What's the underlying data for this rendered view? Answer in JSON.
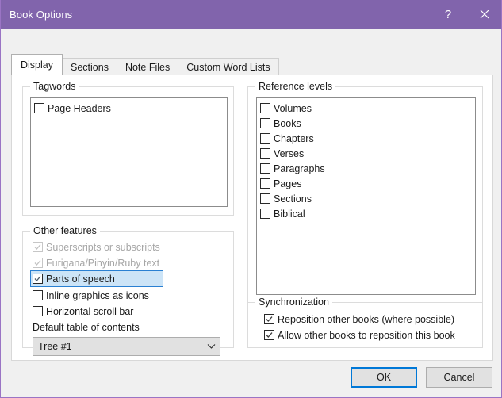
{
  "window": {
    "title": "Book Options",
    "help_button": "?",
    "close_button": "✕",
    "accent_color": "#8164ac"
  },
  "tabs": [
    {
      "label": "Display",
      "active": true
    },
    {
      "label": "Sections",
      "active": false
    },
    {
      "label": "Note Files",
      "active": false
    },
    {
      "label": "Custom Word Lists",
      "active": false
    }
  ],
  "display_tab": {
    "tagwords": {
      "title": "Tagwords",
      "items": [
        {
          "label": "Page Headers",
          "checked": false,
          "enabled": true
        }
      ]
    },
    "other_features": {
      "title": "Other features",
      "items": [
        {
          "label": "Superscripts or subscripts",
          "checked": true,
          "enabled": false,
          "selected": false
        },
        {
          "label": "Furigana/Pinyin/Ruby text",
          "checked": true,
          "enabled": false,
          "selected": false
        },
        {
          "label": "Parts of speech",
          "checked": true,
          "enabled": true,
          "selected": true
        },
        {
          "label": "Inline graphics as icons",
          "checked": false,
          "enabled": true,
          "selected": false
        },
        {
          "label": "Horizontal scroll bar",
          "checked": false,
          "enabled": true,
          "selected": false
        }
      ],
      "default_toc_label": "Default table of contents",
      "default_toc_value": "Tree #1"
    },
    "reference_levels": {
      "title": "Reference levels",
      "items": [
        {
          "label": "Volumes",
          "checked": false
        },
        {
          "label": "Books",
          "checked": false
        },
        {
          "label": "Chapters",
          "checked": false
        },
        {
          "label": "Verses",
          "checked": false
        },
        {
          "label": "Paragraphs",
          "checked": false
        },
        {
          "label": "Pages",
          "checked": false
        },
        {
          "label": "Sections",
          "checked": false
        },
        {
          "label": "Biblical",
          "checked": false
        }
      ]
    },
    "synchronization": {
      "title": "Synchronization",
      "items": [
        {
          "label": "Reposition other books (where possible)",
          "checked": true,
          "enabled": true
        },
        {
          "label": "Allow other books to reposition this book",
          "checked": true,
          "enabled": true
        }
      ]
    }
  },
  "footer": {
    "ok_label": "OK",
    "cancel_label": "Cancel",
    "default_button": "OK"
  }
}
